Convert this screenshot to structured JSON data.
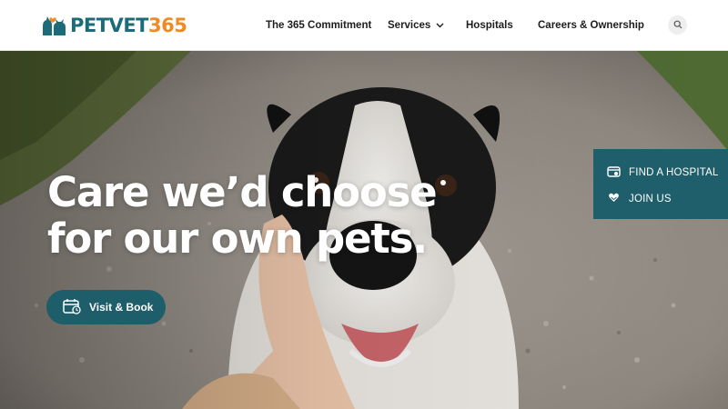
{
  "brand": {
    "name_part1": "PETVET",
    "name_part2": "365",
    "logo_icon": "pets-logo-icon",
    "colors": {
      "teal": "#1d6a78",
      "orange": "#f08a24"
    }
  },
  "nav": {
    "items": [
      {
        "label": "The 365 Commitment"
      },
      {
        "label": "Services",
        "icon": "chevron-down-icon"
      },
      {
        "label": "Hospitals"
      },
      {
        "label": "Careers & Ownership"
      }
    ],
    "search_icon": "search-icon"
  },
  "hero": {
    "headline_line1": "Care we’d choose",
    "headline_line2": "for our own pets.",
    "cta_label": "Visit & Book",
    "cta_icon": "calendar-icon",
    "image": "dog-photo"
  },
  "side_panel": {
    "items": [
      {
        "label": "FIND A HOSPITAL",
        "icon": "hospital-card-icon"
      },
      {
        "label": "JOIN US",
        "icon": "heart-hands-icon"
      }
    ],
    "color": "#1f5f6b"
  }
}
